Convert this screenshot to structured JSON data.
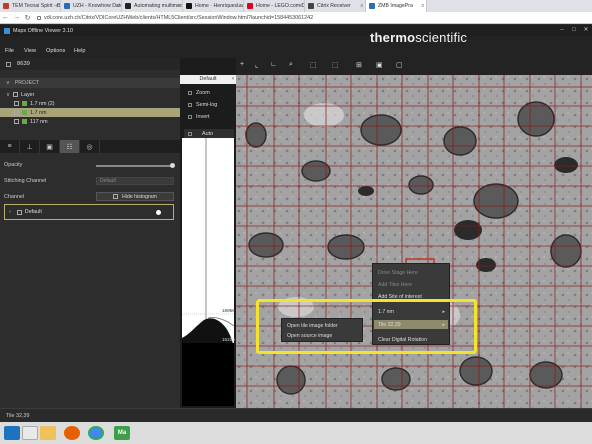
{
  "browser": {
    "tabs": [
      {
        "title": "TEM Tecnai Spirit - Basic Se",
        "icon_color": "#c0392b",
        "active": false
      },
      {
        "title": "UZH - Knowhow Datenbank",
        "icon_color": "#2d68b4",
        "active": false
      },
      {
        "title": "Automating multimodal mi",
        "icon_color": "#222222",
        "active": false
      },
      {
        "title": "Home · HenriquesLab/Nan",
        "icon_color": "#111111",
        "active": false
      },
      {
        "title": "Home - LEGO.com DE",
        "icon_color": "#e3001b",
        "active": false
      },
      {
        "title": "Citrix Receiver",
        "icon_color": "#444444",
        "active": false
      },
      {
        "title": "ZMB ImagePra",
        "icon_color": "#2a6ebb",
        "active": true
      }
    ],
    "close_glyph": "x",
    "nav": {
      "back": "←",
      "forward": "→",
      "reload": "↻"
    },
    "url": "vdi.core.uzh.ch/Citrix/VDICoreUZHWeb/clients/HTML5Client/src/SessionWindow.html?launchid=1584453061242"
  },
  "app": {
    "title": "Maps Offline Viewer 3.10",
    "window_controls": [
      "–",
      "□",
      "✕"
    ],
    "menu": [
      "File",
      "View",
      "Options",
      "Help"
    ],
    "brand_prefix": "thermo",
    "brand_suffix": "scientific"
  },
  "left_panel": {
    "id": "8639",
    "project_label": "PROJECT",
    "layers": [
      {
        "label": "Layer",
        "level": 0,
        "highlighted": false
      },
      {
        "label": "1.7 nm (2)",
        "level": 1,
        "highlighted": false
      },
      {
        "label": "1.7 nm",
        "level": 1,
        "highlighted": true
      },
      {
        "label": "117 nm",
        "level": 1,
        "highlighted": false
      }
    ],
    "tool_icons": [
      "layers-icon",
      "pin-icon",
      "image-icon",
      "adjust-icon",
      "compass-icon"
    ],
    "opacity_label": "Opacity",
    "opacity_value": 1.0,
    "stitching_label": "Stitching Channel",
    "stitching_value": "Default",
    "channel_label": "Channel",
    "hide_histogram": "Hide histogram",
    "channel_name": "Default"
  },
  "histogram": {
    "tab": "Default",
    "options": [
      "Zoom",
      "Semi-log",
      "Invert"
    ],
    "auto": "Auto",
    "label_high": "18956",
    "label_low": "15216"
  },
  "viewer": {
    "toolbar_icons": [
      "+",
      "⌞",
      "∟",
      "⌕",
      "⬚",
      "⬚",
      "⊞",
      "▣",
      "▢"
    ]
  },
  "context_menu": {
    "items": [
      {
        "label": "Drive Stage Here",
        "enabled": false
      },
      {
        "label": "Add Tiles Here",
        "enabled": false
      },
      {
        "label": "Add Site of interest",
        "enabled": true
      },
      {
        "label": "1.7 nm",
        "enabled": true,
        "submenu": true
      },
      {
        "label": "Tile 32,39",
        "enabled": true,
        "submenu": true,
        "highlighted": true
      },
      {
        "label": "Clear Digital Rotation",
        "enabled": true
      }
    ],
    "submenu": [
      "Open tile image folder",
      "Open source image"
    ]
  },
  "status_bar": {
    "text": "Tile 32,39"
  },
  "taskbar": {
    "icons": [
      "windows-start-icon",
      "search-icon",
      "file-explorer-icon",
      "firefox-icon",
      "chrome-icon",
      "maps-icon"
    ],
    "maps_label": "Ma"
  }
}
